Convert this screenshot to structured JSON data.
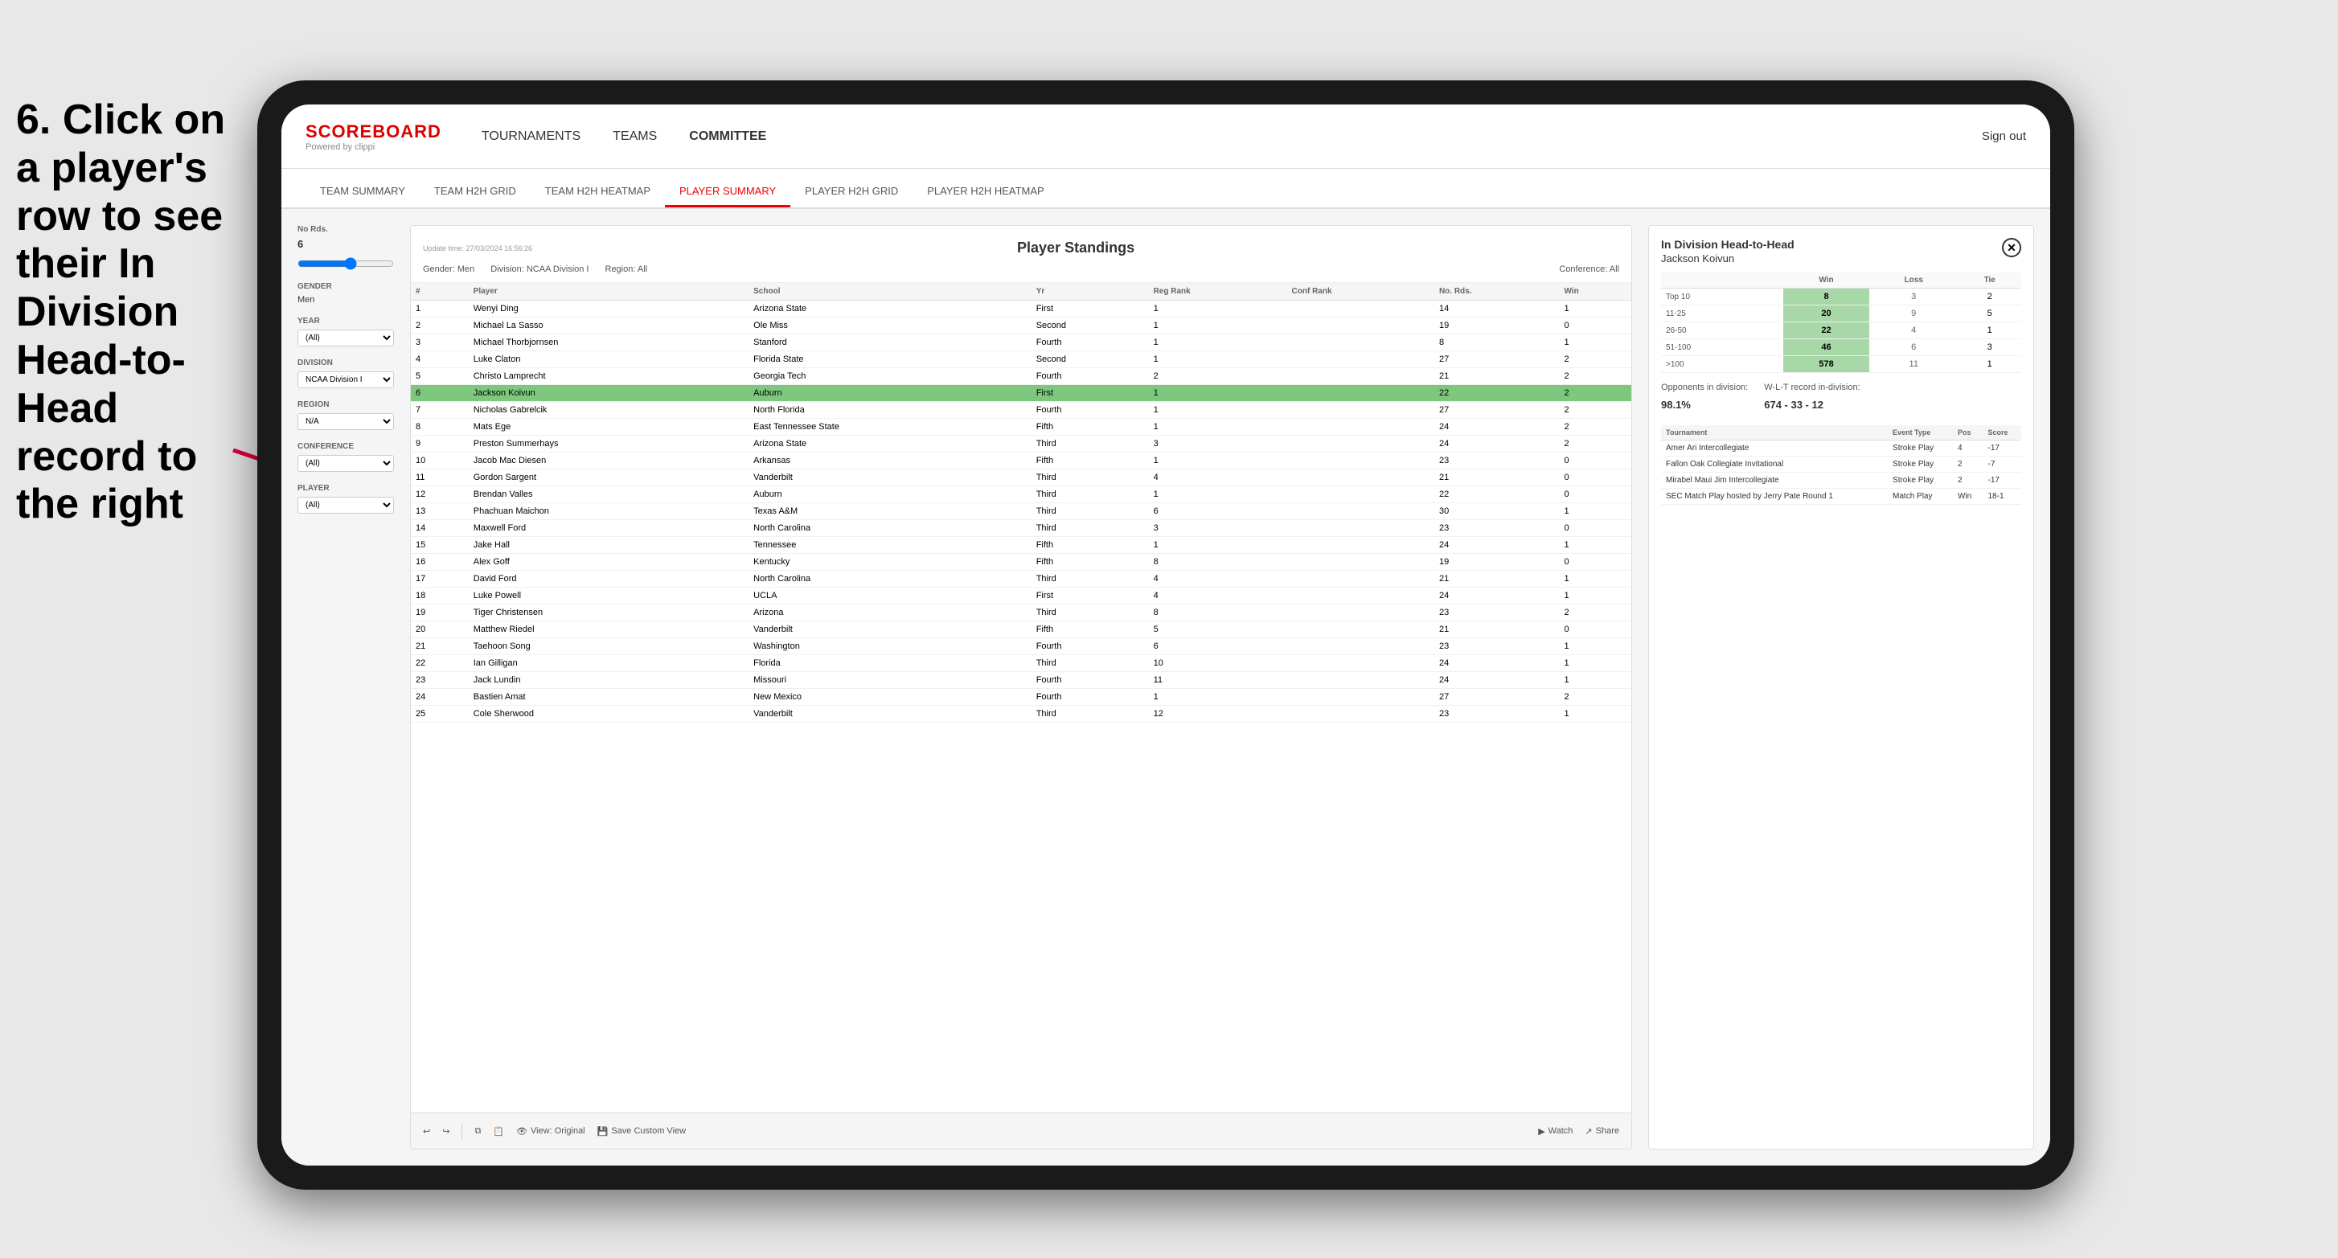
{
  "instruction": {
    "text": "6. Click on a player's row to see their In Division Head-to-Head record to the right"
  },
  "nav": {
    "logo_title": "SCOREBOARD",
    "logo_subtitle": "Powered by clippi",
    "items": [
      "TOURNAMENTS",
      "TEAMS",
      "COMMITTEE"
    ],
    "sign_out": "Sign out"
  },
  "sub_nav": {
    "items": [
      "TEAM SUMMARY",
      "TEAM H2H GRID",
      "TEAM H2H HEATMAP",
      "PLAYER SUMMARY",
      "PLAYER H2H GRID",
      "PLAYER H2H HEATMAP"
    ],
    "active": "PLAYER SUMMARY"
  },
  "sidebar": {
    "no_rds_label": "No Rds.",
    "no_rds_value": "6",
    "gender_label": "Gender",
    "gender_value": "Men",
    "year_label": "Year",
    "year_value": "(All)",
    "division_label": "Division",
    "division_value": "NCAA Division I",
    "region_label": "Region",
    "region_value": "N/A",
    "conference_label": "Conference",
    "conference_value": "(All)",
    "player_label": "Player",
    "player_value": "(All)"
  },
  "standings": {
    "title": "Player Standings",
    "update_time": "Update time:",
    "update_datetime": "27/03/2024 16:56:26",
    "gender_label": "Gender:",
    "gender_value": "Men",
    "division_label": "Division:",
    "division_value": "NCAA Division I",
    "region_label": "Region:",
    "region_value": "All",
    "conference_label": "Conference:",
    "conference_value": "All",
    "columns": [
      "#",
      "Player",
      "School",
      "Yr",
      "Reg Rank",
      "Conf Rank",
      "No. Rds.",
      "Win"
    ],
    "rows": [
      {
        "num": 1,
        "player": "Wenyi Ding",
        "school": "Arizona State",
        "yr": "First",
        "reg_rank": 1,
        "conf_rank": "",
        "no_rds": 14,
        "win": 1
      },
      {
        "num": 2,
        "player": "Michael La Sasso",
        "school": "Ole Miss",
        "yr": "Second",
        "reg_rank": 1,
        "conf_rank": "",
        "no_rds": 19,
        "win": 0
      },
      {
        "num": 3,
        "player": "Michael Thorbjornsen",
        "school": "Stanford",
        "yr": "Fourth",
        "reg_rank": 1,
        "conf_rank": "",
        "no_rds": 8,
        "win": 1
      },
      {
        "num": 4,
        "player": "Luke Claton",
        "school": "Florida State",
        "yr": "Second",
        "reg_rank": 1,
        "conf_rank": "",
        "no_rds": 27,
        "win": 2
      },
      {
        "num": 5,
        "player": "Christo Lamprecht",
        "school": "Georgia Tech",
        "yr": "Fourth",
        "reg_rank": 2,
        "conf_rank": "",
        "no_rds": 21,
        "win": 2
      },
      {
        "num": 6,
        "player": "Jackson Koivun",
        "school": "Auburn",
        "yr": "First",
        "reg_rank": 1,
        "conf_rank": "",
        "no_rds": 22,
        "win": 2,
        "highlighted": true
      },
      {
        "num": 7,
        "player": "Nicholas Gabrelcik",
        "school": "North Florida",
        "yr": "Fourth",
        "reg_rank": 1,
        "conf_rank": "",
        "no_rds": 27,
        "win": 2
      },
      {
        "num": 8,
        "player": "Mats Ege",
        "school": "East Tennessee State",
        "yr": "Fifth",
        "reg_rank": 1,
        "conf_rank": "",
        "no_rds": 24,
        "win": 2
      },
      {
        "num": 9,
        "player": "Preston Summerhays",
        "school": "Arizona State",
        "yr": "Third",
        "reg_rank": 3,
        "conf_rank": "",
        "no_rds": 24,
        "win": 2
      },
      {
        "num": 10,
        "player": "Jacob Mac Diesen",
        "school": "Arkansas",
        "yr": "Fifth",
        "reg_rank": 1,
        "conf_rank": "",
        "no_rds": 23,
        "win": 0
      },
      {
        "num": 11,
        "player": "Gordon Sargent",
        "school": "Vanderbilt",
        "yr": "Third",
        "reg_rank": 4,
        "conf_rank": "",
        "no_rds": 21,
        "win": 0
      },
      {
        "num": 12,
        "player": "Brendan Valles",
        "school": "Auburn",
        "yr": "Third",
        "reg_rank": 1,
        "conf_rank": "",
        "no_rds": 22,
        "win": 0
      },
      {
        "num": 13,
        "player": "Phachuan Maichon",
        "school": "Texas A&M",
        "yr": "Third",
        "reg_rank": 6,
        "conf_rank": "",
        "no_rds": 30,
        "win": 1
      },
      {
        "num": 14,
        "player": "Maxwell Ford",
        "school": "North Carolina",
        "yr": "Third",
        "reg_rank": 3,
        "conf_rank": "",
        "no_rds": 23,
        "win": 0
      },
      {
        "num": 15,
        "player": "Jake Hall",
        "school": "Tennessee",
        "yr": "Fifth",
        "reg_rank": 1,
        "conf_rank": "",
        "no_rds": 24,
        "win": 1
      },
      {
        "num": 16,
        "player": "Alex Goff",
        "school": "Kentucky",
        "yr": "Fifth",
        "reg_rank": 8,
        "conf_rank": "",
        "no_rds": 19,
        "win": 0
      },
      {
        "num": 17,
        "player": "David Ford",
        "school": "North Carolina",
        "yr": "Third",
        "reg_rank": 4,
        "conf_rank": "",
        "no_rds": 21,
        "win": 1
      },
      {
        "num": 18,
        "player": "Luke Powell",
        "school": "UCLA",
        "yr": "First",
        "reg_rank": 4,
        "conf_rank": "",
        "no_rds": 24,
        "win": 1
      },
      {
        "num": 19,
        "player": "Tiger Christensen",
        "school": "Arizona",
        "yr": "Third",
        "reg_rank": 8,
        "conf_rank": "",
        "no_rds": 23,
        "win": 2
      },
      {
        "num": 20,
        "player": "Matthew Riedel",
        "school": "Vanderbilt",
        "yr": "Fifth",
        "reg_rank": 5,
        "conf_rank": "",
        "no_rds": 21,
        "win": 0
      },
      {
        "num": 21,
        "player": "Taehoon Song",
        "school": "Washington",
        "yr": "Fourth",
        "reg_rank": 6,
        "conf_rank": "",
        "no_rds": 23,
        "win": 1
      },
      {
        "num": 22,
        "player": "Ian Gilligan",
        "school": "Florida",
        "yr": "Third",
        "reg_rank": 10,
        "conf_rank": "",
        "no_rds": 24,
        "win": 1
      },
      {
        "num": 23,
        "player": "Jack Lundin",
        "school": "Missouri",
        "yr": "Fourth",
        "reg_rank": 11,
        "conf_rank": "",
        "no_rds": 24,
        "win": 1
      },
      {
        "num": 24,
        "player": "Bastien Amat",
        "school": "New Mexico",
        "yr": "Fourth",
        "reg_rank": 1,
        "conf_rank": "",
        "no_rds": 27,
        "win": 2
      },
      {
        "num": 25,
        "player": "Cole Sherwood",
        "school": "Vanderbilt",
        "yr": "Third",
        "reg_rank": 12,
        "conf_rank": "",
        "no_rds": 23,
        "win": 1
      }
    ]
  },
  "h2h": {
    "title": "In Division Head-to-Head",
    "player": "Jackson Koivun",
    "table_headers": [
      "",
      "Win",
      "Loss",
      "Tie"
    ],
    "rows": [
      {
        "range": "Top 10",
        "win": 8,
        "loss": 3,
        "tie": 2
      },
      {
        "range": "11-25",
        "win": 20,
        "loss": 9,
        "tie": 5
      },
      {
        "range": "26-50",
        "win": 22,
        "loss": 4,
        "tie": 1
      },
      {
        "range": "51-100",
        "win": 46,
        "loss": 6,
        "tie": 3
      },
      {
        "range": ">100",
        "win": 578,
        "loss": 11,
        "tie": 1
      }
    ],
    "opponents_label": "Opponents in division:",
    "wlt_label": "W-L-T record in-division:",
    "opponents_pct": "98.1%",
    "record": "674 - 33 - 12",
    "tournament_cols": [
      "Tournament",
      "Event Type",
      "Pos",
      "Score"
    ],
    "tournaments": [
      {
        "name": "Amer Ari Intercollegiate",
        "type": "Stroke Play",
        "pos": 4,
        "score": -17
      },
      {
        "name": "Fallon Oak Collegiate Invitational",
        "type": "Stroke Play",
        "pos": 2,
        "score": -7
      },
      {
        "name": "Mirabel Maui Jim Intercollegiate",
        "type": "Stroke Play",
        "pos": 2,
        "score": -17
      },
      {
        "name": "SEC Match Play hosted by Jerry Pate Round 1",
        "type": "Match Play",
        "pos": "Win",
        "score": "18-1"
      }
    ]
  },
  "toolbar": {
    "view_original": "View: Original",
    "save_custom": "Save Custom View",
    "watch": "Watch",
    "share": "Share"
  }
}
